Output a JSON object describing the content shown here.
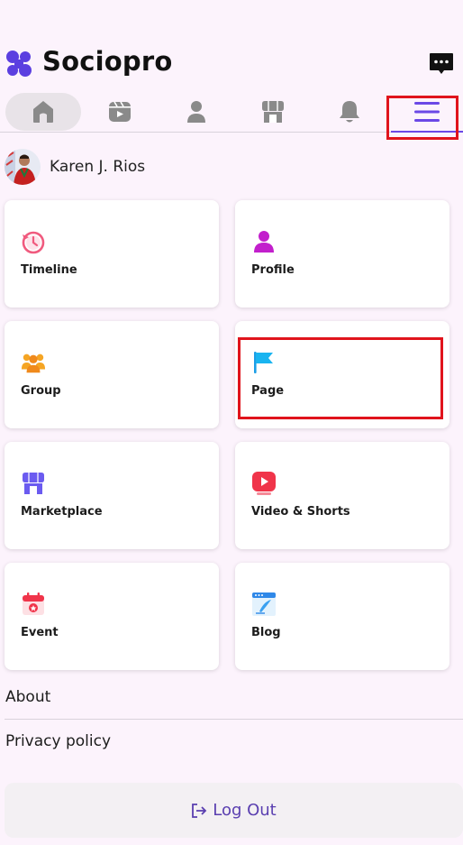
{
  "app": {
    "brand": "Sociopro"
  },
  "user": {
    "name": "Karen J. Rios"
  },
  "nav": {
    "items": [
      {
        "name": "home",
        "icon": "home-icon"
      },
      {
        "name": "reels",
        "icon": "video-icon"
      },
      {
        "name": "profile",
        "icon": "person-icon"
      },
      {
        "name": "marketplace",
        "icon": "store-icon"
      },
      {
        "name": "notifications",
        "icon": "bell-icon"
      },
      {
        "name": "menu",
        "icon": "hamburger-icon"
      }
    ]
  },
  "cards": [
    {
      "label": "Timeline",
      "icon": "history-icon"
    },
    {
      "label": "Profile",
      "icon": "person-icon"
    },
    {
      "label": "Group",
      "icon": "group-icon"
    },
    {
      "label": "Page",
      "icon": "flag-icon"
    },
    {
      "label": "Marketplace",
      "icon": "store-icon"
    },
    {
      "label": "Video & Shorts",
      "icon": "play-icon"
    },
    {
      "label": "Event",
      "icon": "calendar-icon"
    },
    {
      "label": "Blog",
      "icon": "blog-icon"
    }
  ],
  "links": {
    "about": "About",
    "privacy": "Privacy policy"
  },
  "logout": {
    "label": "Log Out"
  },
  "colors": {
    "background": "#fcf3fc",
    "accent": "#6b48e6",
    "highlight": "#e0141c",
    "logout_text": "#5a3fb0"
  }
}
